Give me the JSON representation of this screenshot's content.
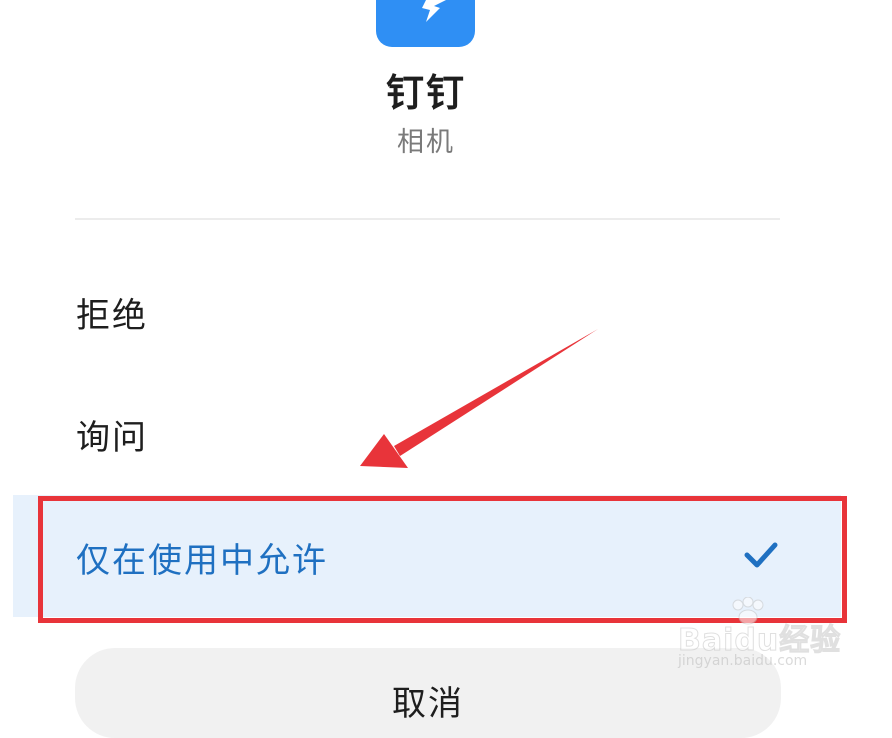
{
  "header": {
    "app_icon": "dingtalk-icon",
    "app_name": "钉钉",
    "permission": "相机"
  },
  "options": [
    {
      "label": "拒绝",
      "selected": false
    },
    {
      "label": "询问",
      "selected": false
    },
    {
      "label": "仅在使用中允许",
      "selected": true
    }
  ],
  "cancel_label": "取消",
  "watermark": {
    "brand": "Baidu经验",
    "url": "jingyan.baidu.com"
  },
  "colors": {
    "accent": "#1f70c1",
    "selected_background": "#e7f1fc",
    "annotation": "#e8343a",
    "app_icon": "#2f8ff4"
  }
}
